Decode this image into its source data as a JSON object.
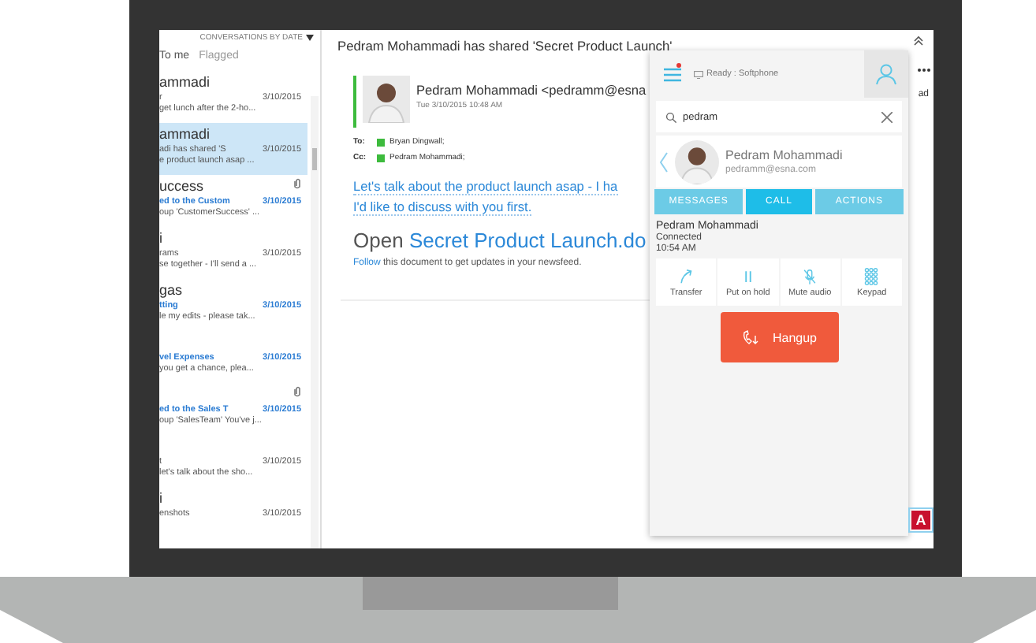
{
  "mail_list": {
    "sort_label": "CONVERSATIONS BY DATE",
    "filters": [
      {
        "label": "To me",
        "selected": true
      },
      {
        "label": "Flagged",
        "selected": false
      }
    ],
    "items": [
      {
        "sender": "ammadi",
        "subject": "r",
        "date": "3/10/2015",
        "preview": "get lunch after the 2-ho...",
        "selected": false,
        "unread": false,
        "attachment": false
      },
      {
        "sender": "ammadi",
        "subject": "adi has shared 'S",
        "date": "3/10/2015",
        "preview": "e product launch asap ...",
        "selected": true,
        "unread": false,
        "attachment": false
      },
      {
        "sender": "uccess",
        "subject": "ed to the Custom",
        "date": "3/10/2015",
        "preview": "oup 'CustomerSuccess' ...",
        "selected": false,
        "unread": true,
        "attachment": true
      },
      {
        "sender": "i",
        "subject": "rams",
        "date": "3/10/2015",
        "preview": "se together - I'll send a ...",
        "selected": false,
        "unread": false,
        "attachment": false
      },
      {
        "sender": "gas",
        "subject": "tting",
        "date": "3/10/2015",
        "preview": "le my edits - please tak...",
        "selected": false,
        "unread": true,
        "attachment": false
      },
      {
        "subject": "vel Expenses",
        "date": "3/10/2015",
        "preview": "you get a chance, plea...",
        "selected": false,
        "unread": true,
        "attachment": false
      },
      {
        "subject": "ed to the Sales T",
        "date": "3/10/2015",
        "preview": "oup 'SalesTeam' You've j...",
        "selected": false,
        "unread": true,
        "attachment": true
      },
      {
        "subject": "t",
        "date": "3/10/2015",
        "preview": "let's talk about the sho...",
        "selected": false,
        "unread": false,
        "attachment": false
      },
      {
        "sender": "i",
        "subject": "enshots",
        "date": "3/10/2015",
        "selected": false,
        "unread": false,
        "attachment": false
      }
    ]
  },
  "message": {
    "subject": "Pedram Mohammadi has shared 'Secret Product Launch'",
    "sender": "Pedram Mohammadi <pedramm@esna",
    "sent": "Tue 3/10/2015 10:48 AM",
    "to_label": "To:",
    "to": "Bryan Dingwall;",
    "cc_label": "Cc:",
    "cc": "Pedram Mohammadi;",
    "body_lines": [
      "Let's talk about the product launch asap - I ha",
      "I'd like to discuss with you first."
    ],
    "open_label": "Open",
    "doc_link": "Secret Product Launch.do",
    "follow_link": "Follow",
    "follow_text": "this document to get updates in your newsfeed.",
    "side_text": "ad"
  },
  "dialer": {
    "status": "Ready : Softphone",
    "notification": true,
    "search": {
      "value": "pedram"
    },
    "contact": {
      "name": "Pedram Mohammadi",
      "email": "pedramm@esna.com"
    },
    "tabs": [
      {
        "label": "MESSAGES",
        "selected": false
      },
      {
        "label": "CALL",
        "selected": true
      },
      {
        "label": "ACTIONS",
        "selected": false
      }
    ],
    "call": {
      "name": "Pedram Mohammadi",
      "status": "Connected",
      "time": "10:54 AM"
    },
    "actions": [
      {
        "kind": "transfer",
        "label": "Transfer"
      },
      {
        "kind": "hold",
        "label": "Put on hold"
      },
      {
        "kind": "mute",
        "label": "Mute audio"
      },
      {
        "kind": "keypad",
        "label": "Keypad"
      }
    ],
    "hangup": "Hangup"
  },
  "logo": {
    "letter": "A"
  }
}
